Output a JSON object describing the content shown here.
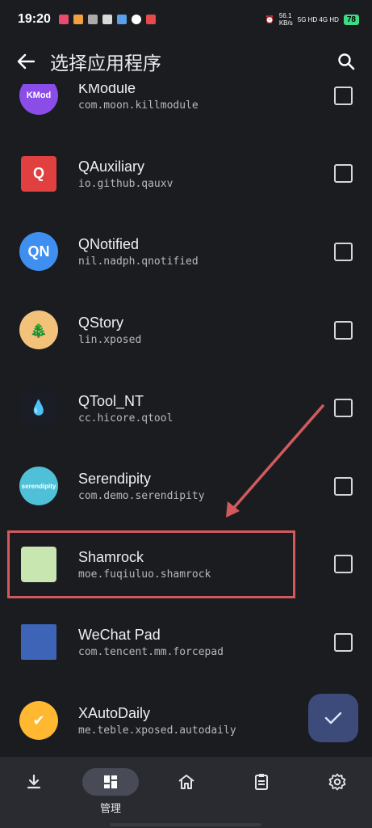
{
  "status_bar": {
    "time": "19:20",
    "net_speed": "56.1\nKB/s",
    "signal": "5G HD  4G HD",
    "battery": "78"
  },
  "header": {
    "title": "选择应用程序"
  },
  "apps": [
    {
      "name": "KModule",
      "package": "com.moon.killmodule",
      "icon_text": "KMod",
      "color": "#8a4de8"
    },
    {
      "name": "QAuxiliary",
      "package": "io.github.qauxv",
      "icon_text": "Q",
      "color": "#e04040"
    },
    {
      "name": "QNotified",
      "package": "nil.nadph.qnotified",
      "icon_text": "QN",
      "color": "#3e8ff0"
    },
    {
      "name": "QStory",
      "package": "lin.xposed",
      "icon_text": "🎄",
      "color": "#f2c27a"
    },
    {
      "name": "QTool_NT",
      "package": "cc.hicore.qtool",
      "icon_text": "💧",
      "color": "#1a1d26"
    },
    {
      "name": "Serendipity",
      "package": "com.demo.serendipity",
      "icon_text": "serendipity",
      "color": "#4fc0d8"
    },
    {
      "name": "Shamrock",
      "package": "moe.fuqiuluo.shamrock",
      "icon_text": "",
      "color": "#c8e6b0"
    },
    {
      "name": "WeChat Pad",
      "package": "com.tencent.mm.forcepad",
      "icon_text": "",
      "color": "#3e64b8"
    },
    {
      "name": "XAutoDaily",
      "package": "me.teble.xposed.autodaily",
      "icon_text": "✔",
      "color": "#ffb830"
    }
  ],
  "nav": {
    "items": [
      {
        "icon": "download-icon",
        "label": ""
      },
      {
        "icon": "manage-icon",
        "label": "管理"
      },
      {
        "icon": "home-icon",
        "label": ""
      },
      {
        "icon": "clipboard-icon",
        "label": ""
      },
      {
        "icon": "settings-icon",
        "label": ""
      }
    ]
  },
  "colors": {
    "background": "#1b1c20",
    "fab": "#3d4b7a",
    "highlight": "#d25a5e"
  }
}
